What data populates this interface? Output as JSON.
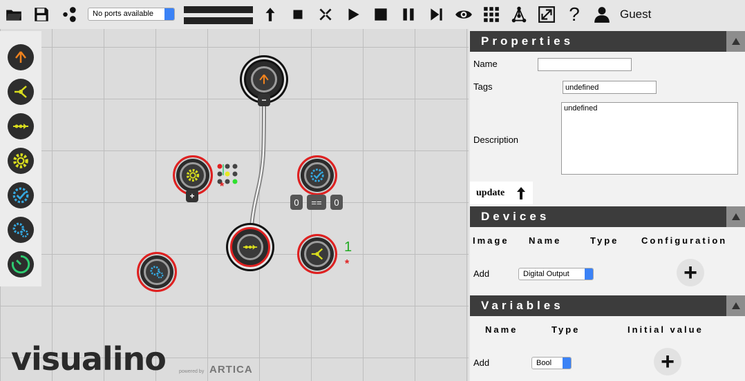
{
  "toolbar": {
    "ports_select": "No ports available",
    "user_name": "Guest",
    "help_label": "?"
  },
  "canvas": {
    "mini_minus": "−",
    "mini_plus": "+",
    "compare_left": "0",
    "compare_op": "==",
    "compare_right": "0",
    "pin_label": "1",
    "asterisk": "*"
  },
  "branding": {
    "logo": "visualino",
    "powered_by": "powered by",
    "partner": "ARTICA"
  },
  "properties": {
    "title": "Properties",
    "name_label": "Name",
    "name_value": "",
    "tags_label": "Tags",
    "tags_value": "undefined",
    "description_label": "Description",
    "description_value": "undefined",
    "update_label": "update"
  },
  "devices": {
    "title": "Devices",
    "columns": [
      "Image",
      "Name",
      "Type",
      "Configuration"
    ],
    "add_label": "Add",
    "add_select": "Digital Output"
  },
  "variables": {
    "title": "Variables",
    "columns": [
      "Name",
      "Type",
      "Initial value"
    ],
    "add_label": "Add",
    "add_select": "Bool"
  },
  "colors": {
    "accent_orange": "#f0831e",
    "accent_yellow": "#d8dc1e",
    "accent_blue": "#35a8e0",
    "accent_green": "#2ecc71",
    "node_border": "#e02020",
    "header_bg": "#3c3c3c"
  }
}
